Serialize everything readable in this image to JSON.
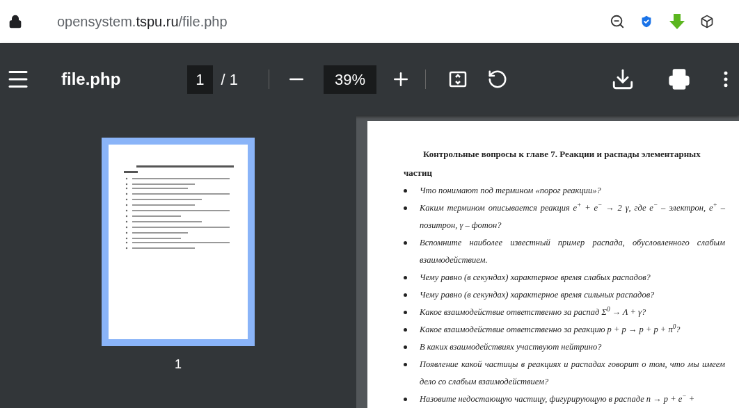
{
  "address_bar": {
    "url_parts": [
      {
        "text": "opensystem.",
        "kind": "dim"
      },
      {
        "text": "tspu.ru",
        "kind": "host"
      },
      {
        "text": "/file.php",
        "kind": "dim"
      }
    ]
  },
  "toolbar": {
    "title": "file.php",
    "page": "1",
    "page_total": "/ 1",
    "zoom": "39%"
  },
  "sidebar": {
    "thumbnails": [
      {
        "label": "1",
        "selected": true
      }
    ]
  },
  "document": {
    "heading_line1": "Контрольные вопросы к главе 7. Реакции и распады элементарных",
    "heading_line2": "частиц",
    "items": [
      "Что понимают под термином «порог реакции»?",
      "Каким термином описывается реакция e$^{+}$ + e$^{−}$ → 2 γ, где e$^{−}$ – электрон, e$^{+}$ – позитрон, γ – фотон?",
      "Вспомните наиболее известный пример распада, обусловленного слабым взаимодействием.",
      "Чему равно (в секундах) характерное время слабых распадов?",
      "Чему равно (в секундах) характерное время сильных распадов?",
      "Какое взаимодействие ответственно за распад Σ$^{0}$ → Λ + γ?",
      "Какое взаимодействие ответственно за реакцию p + p → p + p + π$^{0}$?",
      "В каких взаимодействиях участвуют нейтрино?",
      "Появление какой частицы в реакциях и распадах говорит о том, что мы имеем дело со слабым взаимодействием?",
      "Назовите недостающую частицу, фигурирующую в распаде n → p + e$^{−}$ +"
    ]
  }
}
